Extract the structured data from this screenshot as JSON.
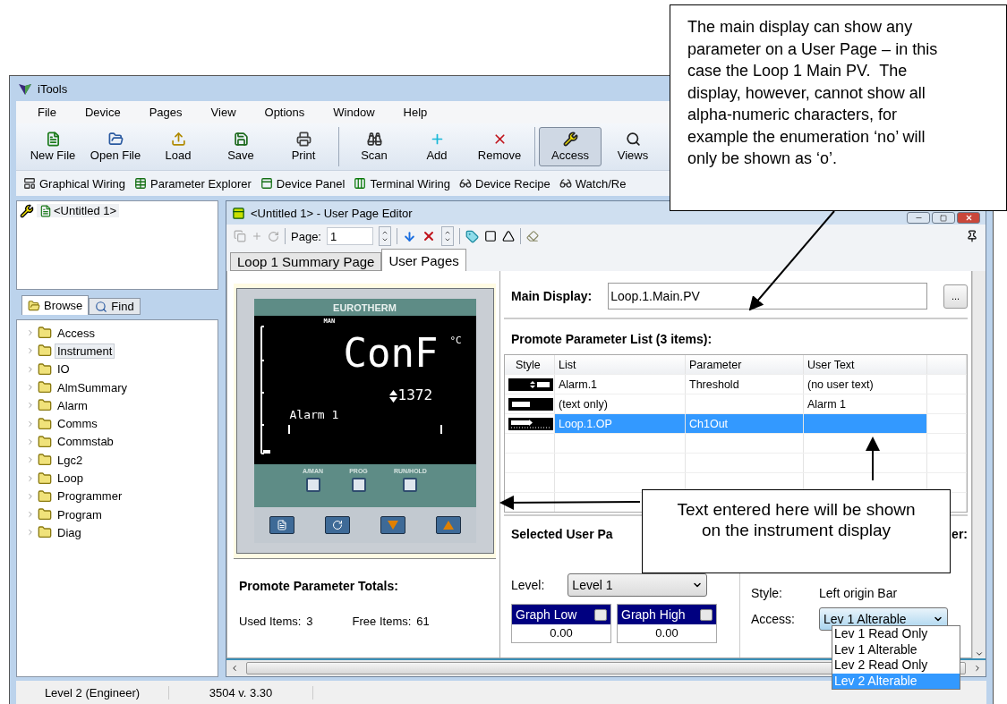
{
  "window": {
    "title": "iTools"
  },
  "menu": [
    {
      "label": "File"
    },
    {
      "label": "Device"
    },
    {
      "label": "Pages"
    },
    {
      "label": "View"
    },
    {
      "label": "Options"
    },
    {
      "label": "Window"
    },
    {
      "label": "Help"
    }
  ],
  "toolbar": {
    "groups": [
      {
        "buttons": [
          {
            "label": "New File",
            "kind": "new",
            "pressed": false
          },
          {
            "label": "Open File",
            "kind": "open",
            "pressed": false
          },
          {
            "label": "Load",
            "kind": "load",
            "pressed": false
          },
          {
            "label": "Save",
            "kind": "save",
            "pressed": false
          },
          {
            "label": "Print",
            "kind": "print",
            "pressed": false
          }
        ]
      },
      {
        "buttons": [
          {
            "label": "Scan",
            "kind": "scan",
            "pressed": false
          },
          {
            "label": "Add",
            "kind": "add",
            "pressed": false
          },
          {
            "label": "Remove",
            "kind": "remove",
            "pressed": false
          }
        ]
      },
      {
        "buttons": [
          {
            "label": "Access",
            "kind": "access",
            "pressed": true
          },
          {
            "label": "Views",
            "kind": "views",
            "pressed": false
          }
        ]
      }
    ]
  },
  "quickbar": [
    {
      "label": "Graphical Wiring",
      "kind": "wiring"
    },
    {
      "label": "Parameter Explorer",
      "kind": "grid"
    },
    {
      "label": "Device Panel",
      "kind": "panel"
    },
    {
      "label": "Terminal Wiring",
      "kind": "terminal"
    },
    {
      "label": "Device Recipe",
      "kind": "recipe"
    },
    {
      "label": "Watch/Re",
      "kind": "watch"
    }
  ],
  "explorer": {
    "root": "<Untitled 1>",
    "tabs": [
      {
        "label": "Browse",
        "selected": true
      },
      {
        "label": "Find",
        "selected": false
      }
    ],
    "tree": [
      {
        "label": "Access",
        "selected": false
      },
      {
        "label": "Instrument",
        "selected": true
      },
      {
        "label": "IO",
        "selected": false
      },
      {
        "label": "AlmSummary",
        "selected": false
      },
      {
        "label": "Alarm",
        "selected": false
      },
      {
        "label": "Comms",
        "selected": false
      },
      {
        "label": "Commstab",
        "selected": false
      },
      {
        "label": "Lgc2",
        "selected": false
      },
      {
        "label": "Loop",
        "selected": false
      },
      {
        "label": "Programmer",
        "selected": false
      },
      {
        "label": "Program",
        "selected": false
      },
      {
        "label": "Diag",
        "selected": false
      }
    ]
  },
  "editor": {
    "title": "<Untitled 1> - User Page Editor",
    "page_label": "Page:",
    "page_value": "1",
    "tabs": [
      {
        "label": "Loop 1 Summary Page",
        "selected": false
      },
      {
        "label": "User Pages",
        "selected": true
      }
    ],
    "instrument": {
      "brand": "EUROTHERM",
      "mode": "MAN",
      "main": "ConF",
      "unit": "°C",
      "value": "1372",
      "text": "Alarm 1",
      "buttons": [
        "A/MAN",
        "PROG",
        "RUN/HOLD"
      ]
    },
    "totals": {
      "title": "Promote Parameter Totals:",
      "used_label": "Used Items:",
      "used": "3",
      "free_label": "Free Items:",
      "free": "61"
    },
    "main_display": {
      "label": "Main Display:",
      "value": "Loop.1.Main.PV",
      "browse": "..."
    },
    "list": {
      "title": "Promote Parameter List (3 items):",
      "columns": [
        "Style",
        "List",
        "Parameter",
        "User Text"
      ],
      "rows": [
        {
          "kind": "alarm",
          "list": "Alarm.1",
          "parameter": "Threshold",
          "user_text": "(no user text)",
          "selected": false
        },
        {
          "kind": "text",
          "list": "(text only)",
          "user_text": "Alarm 1",
          "selected": false
        },
        {
          "kind": "bar",
          "list": "Loop.1.OP",
          "parameter": "Ch1Out",
          "selected": true
        }
      ]
    },
    "selected_item": {
      "title": "Selected User Pa",
      "title_end": "er:",
      "level_label": "Level:",
      "level": "Level 1",
      "graph": [
        {
          "label": "Graph Low",
          "value": "0.00",
          "checked": false
        },
        {
          "label": "Graph High",
          "value": "0.00",
          "checked": false
        }
      ],
      "style_label": "Style:",
      "style": "Left origin Bar",
      "access_label": "Access:",
      "access": "Lev 1 Alterable",
      "access_options": [
        {
          "label": "Lev 1 Read Only",
          "selected": false
        },
        {
          "label": "Lev 1 Alterable",
          "selected": false
        },
        {
          "label": "Lev 2 Read Only",
          "selected": false
        },
        {
          "label": "Lev 2 Alterable",
          "selected": true
        }
      ]
    }
  },
  "status_bar": [
    "Level 2 (Engineer)",
    "3504 v. 3.30"
  ],
  "callouts": [
    {
      "text": "The main display can show any parameter on a User Page – in this case the Loop 1 Main PV.  The display, however, cannot show all alpha-numeric characters, for example the enumeration ‘no’ will only be shown as ‘o’."
    },
    {
      "text": "Text entered here will be shown on the instrument display"
    }
  ]
}
